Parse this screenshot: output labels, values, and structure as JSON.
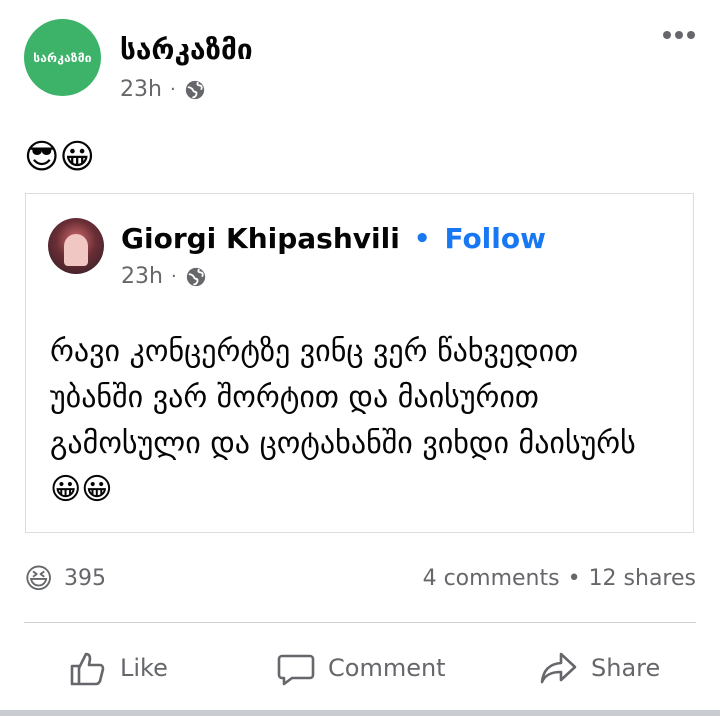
{
  "post": {
    "page_avatar_text": "სარკაზმი",
    "page_name": "სარკაზმი",
    "time": "23h",
    "meta_dot": "·",
    "text": "😎😀"
  },
  "shared": {
    "author": "Giorgi Khipashvili",
    "follow_dot": "•",
    "follow": "Follow",
    "time": "23h",
    "meta_dot": "·",
    "text": "რავი კონცერტზე ვინც ვერ წახვედით უბანში ვარ შორტით და მაისურით გამოსული და ცოტახანში ვიხდი მაისურს 😀😀"
  },
  "stats": {
    "reaction_emoji": "😆",
    "reaction_count": "395",
    "comments": "4 comments",
    "separator": "•",
    "shares": "12 shares"
  },
  "actions": {
    "like": "Like",
    "comment": "Comment",
    "share": "Share"
  },
  "icons": {
    "globe": "globe-icon",
    "more": "more-menu-icon",
    "like": "thumbs-up-icon",
    "comment": "comment-bubble-icon",
    "share": "share-arrow-icon"
  },
  "colors": {
    "page_avatar": "#3db36a",
    "link": "#1877f2",
    "meta": "#65676b"
  }
}
